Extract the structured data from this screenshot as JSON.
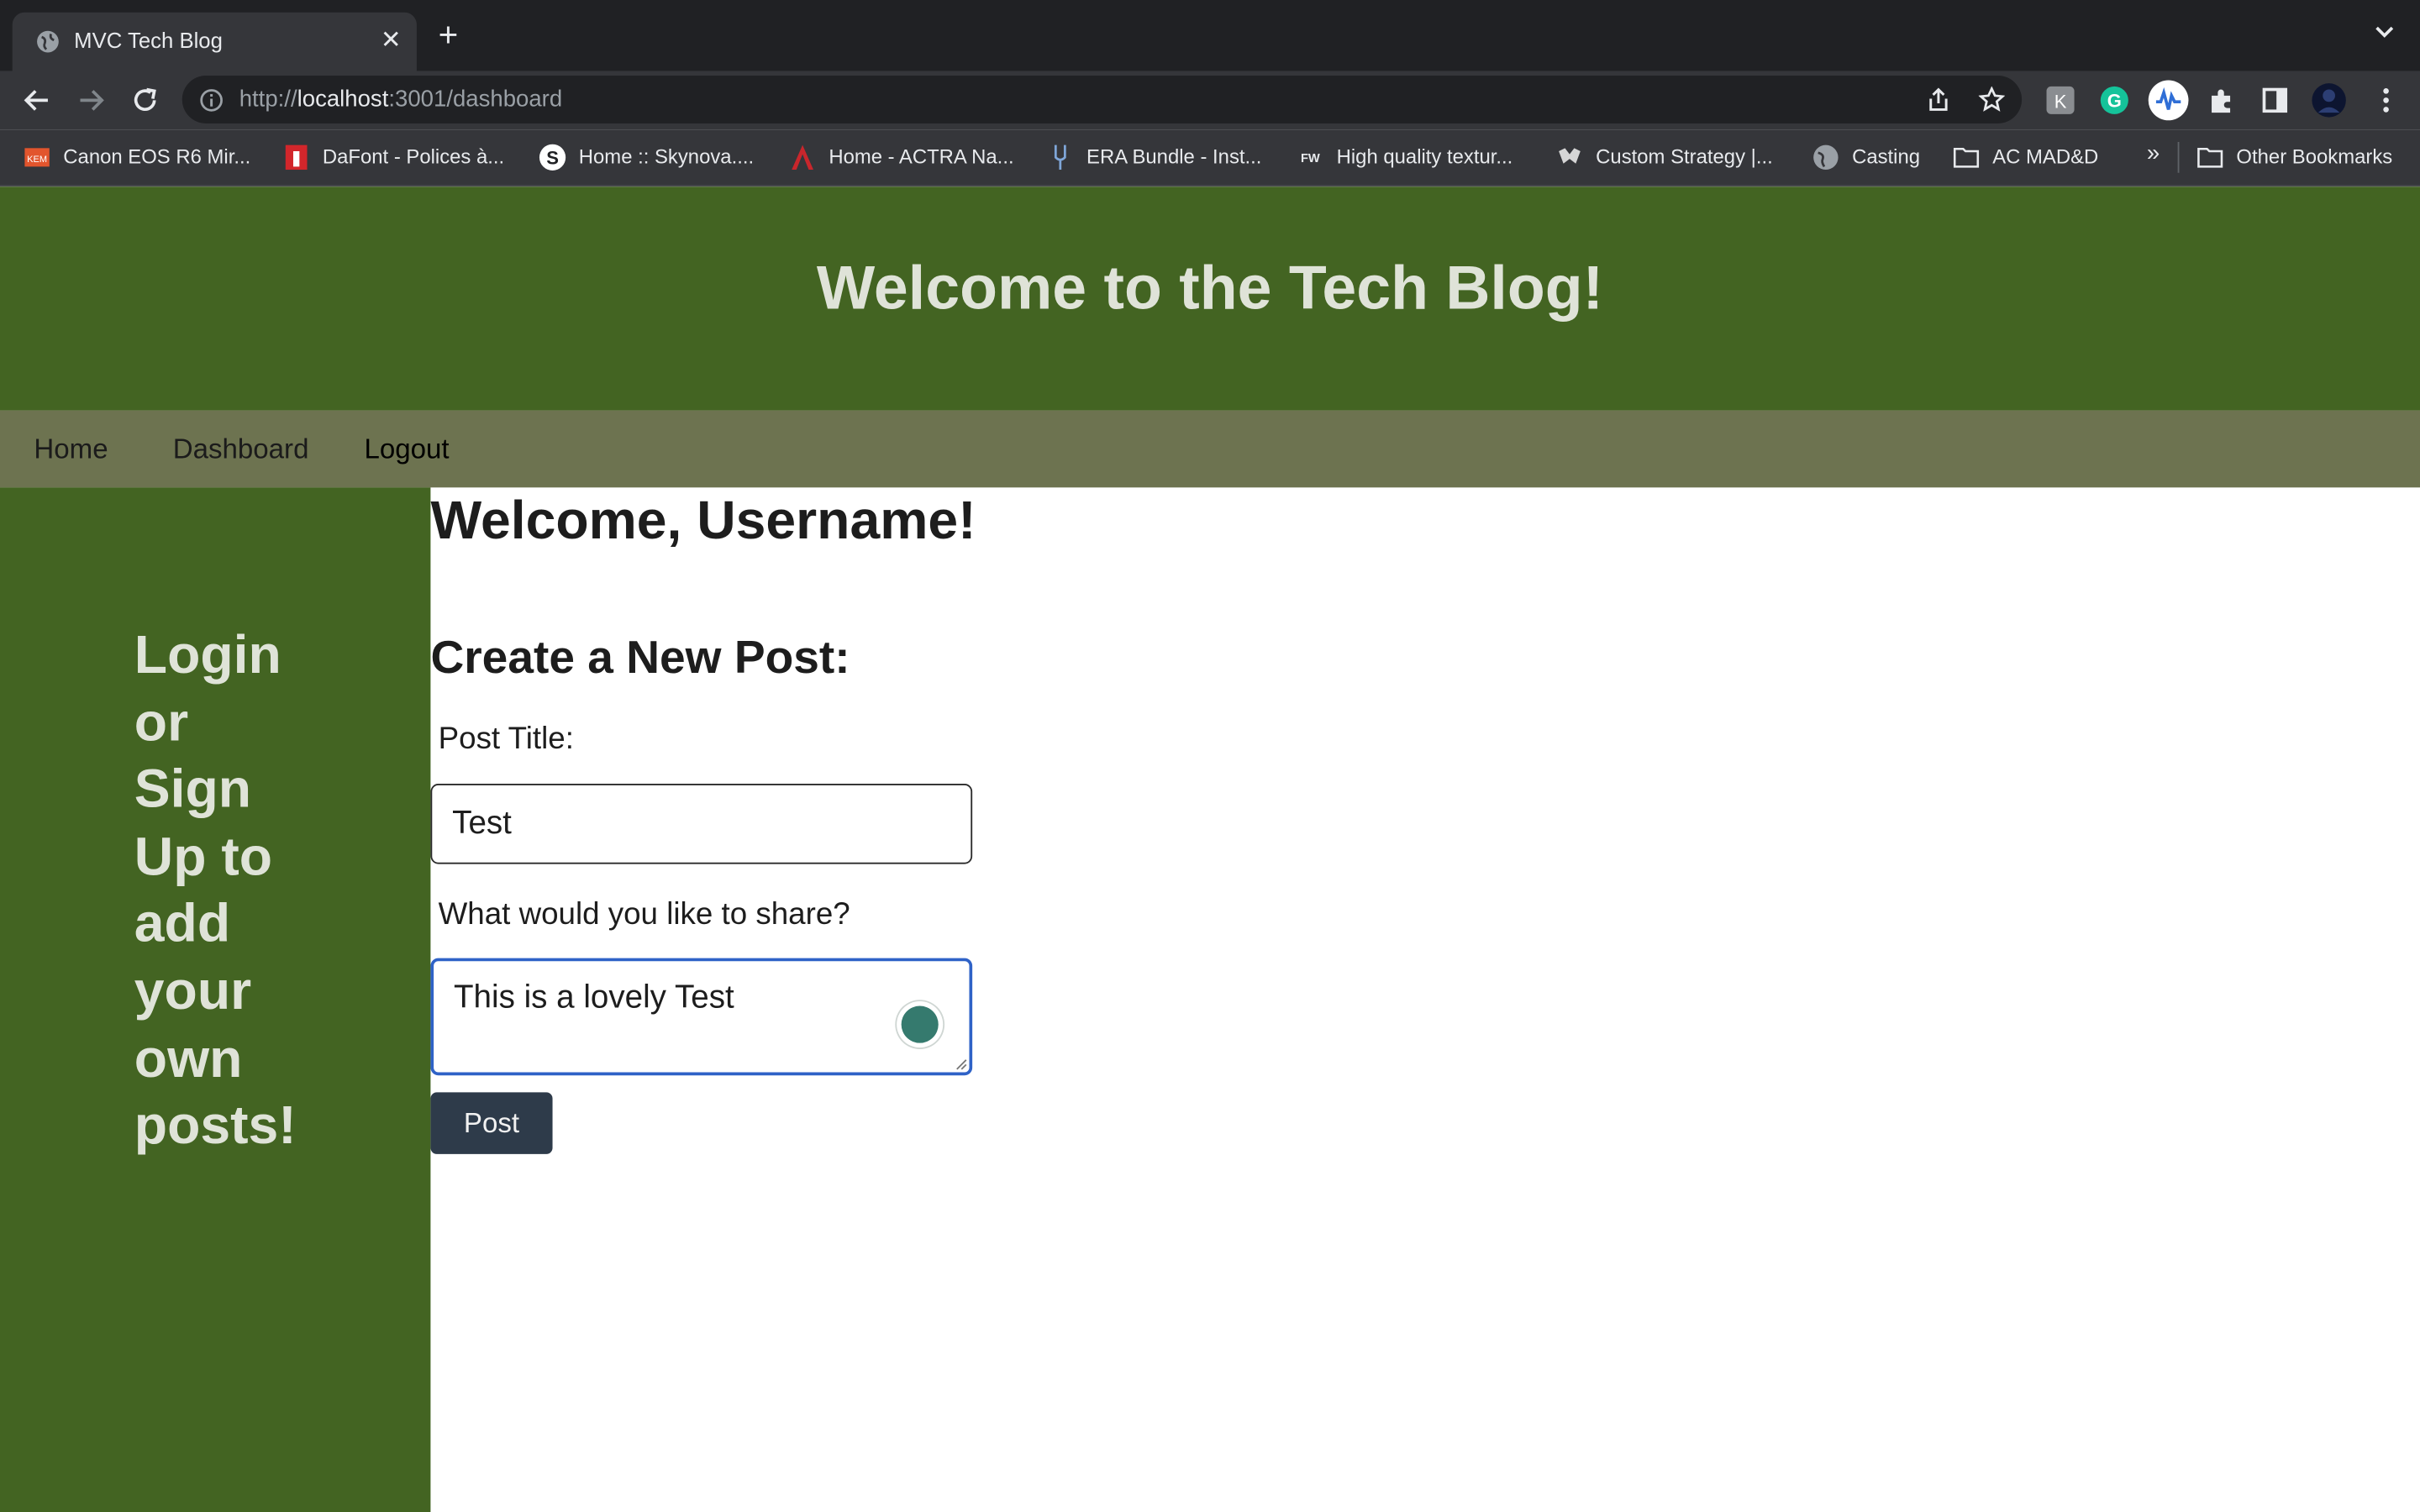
{
  "browser": {
    "tab_title": "MVC Tech Blog",
    "url_scheme": "http://",
    "url_host": "localhost",
    "url_rest": ":3001/dashboard",
    "bookmarks": [
      {
        "label": "Canon EOS R6 Mir...",
        "icon": "kem-icon"
      },
      {
        "label": "DaFont - Polices à...",
        "icon": "dafont-icon"
      },
      {
        "label": "Home :: Skynova....",
        "icon": "skynova-icon"
      },
      {
        "label": "Home - ACTRA Na...",
        "icon": "actra-icon"
      },
      {
        "label": "ERA Bundle - Inst...",
        "icon": "era-icon"
      },
      {
        "label": "High quality textur...",
        "icon": "fw-icon"
      },
      {
        "label": "Custom Strategy |...",
        "icon": "strategy-icon"
      },
      {
        "label": "Casting",
        "icon": "globe-icon"
      },
      {
        "label": "AC MAD&D",
        "icon": "folder-icon"
      }
    ],
    "overflow_label": "»",
    "other_bookmarks": "Other Bookmarks"
  },
  "site": {
    "title": "Welcome to the Tech Blog!",
    "nav": [
      "Home",
      "Dashboard",
      "Logout"
    ],
    "sidebar_message": "Login or Sign Up to add your own posts!"
  },
  "dashboard": {
    "welcome": "Welcome, Username!",
    "create_heading": "Create a New Post:",
    "title_label": "Post Title:",
    "title_value": "Test",
    "content_label": "What would you like to share?",
    "content_value": "This is a lovely Test",
    "post_button": "Post"
  },
  "colors": {
    "header_green": "#436422",
    "nav_olive": "#6d7350",
    "button_dark": "#2e3b4a",
    "focus_blue": "#2f62c7"
  }
}
